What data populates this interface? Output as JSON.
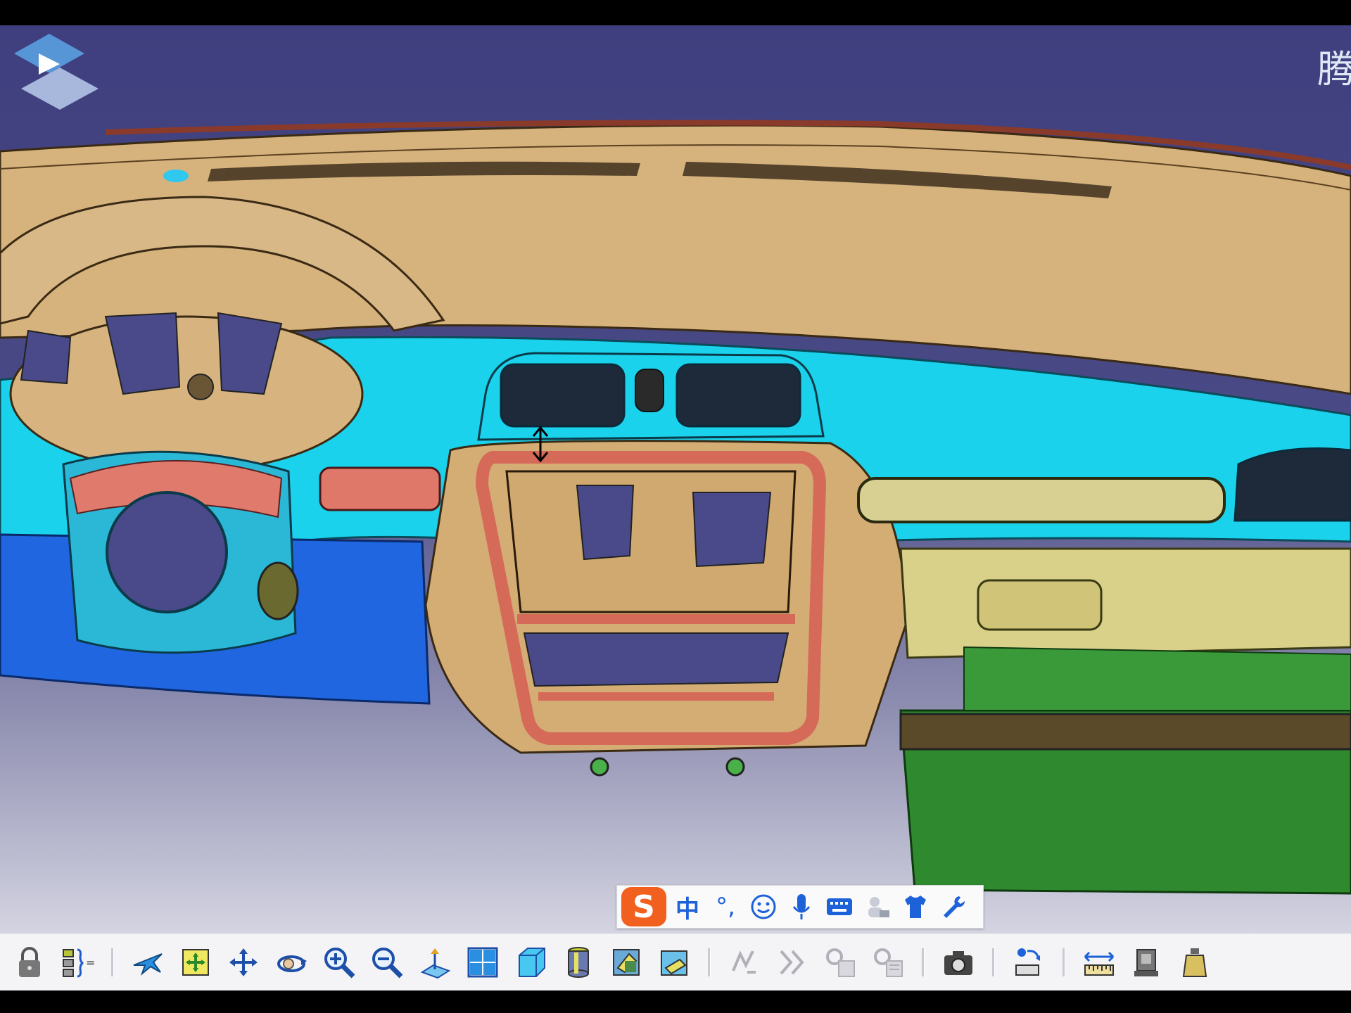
{
  "window": {
    "title": ""
  },
  "logo": {
    "text": "腾"
  },
  "ime_bar": {
    "logo_letter": "S",
    "lang": "中",
    "punct": "°,",
    "items": [
      "emoji-icon",
      "microphone-icon",
      "keyboard-icon",
      "skin-icon",
      "tshirt-icon",
      "wrench-icon"
    ]
  },
  "toolbar": {
    "keyboard_suffix": "=",
    "buttons": [
      "lock-icon",
      "formula-icon",
      "fly-mode-icon",
      "fit-all-icon",
      "pan-icon",
      "rotate-icon",
      "zoom-in-icon",
      "zoom-out-icon",
      "normal-view-icon",
      "multi-view-icon",
      "iso-view-icon",
      "shading-icon",
      "hide-show-icon",
      "swap-space-icon",
      "sketch-icon",
      "arrow-forward-icon",
      "catalog-icon",
      "catalog-2-icon",
      "capture-icon",
      "measure-icon",
      "measure-between-icon",
      "measure-item-icon",
      "measure-inertia-icon"
    ]
  },
  "colors": {
    "background_top": "#3f3f7f",
    "dashboard_tan": "#d2ae7a",
    "cyan_panel": "#19d4ee",
    "blue_lower": "#1f66e0",
    "salmon_trim": "#d86a5a",
    "glovebox": "#d8d08a",
    "green_part": "#2f8a2f"
  }
}
